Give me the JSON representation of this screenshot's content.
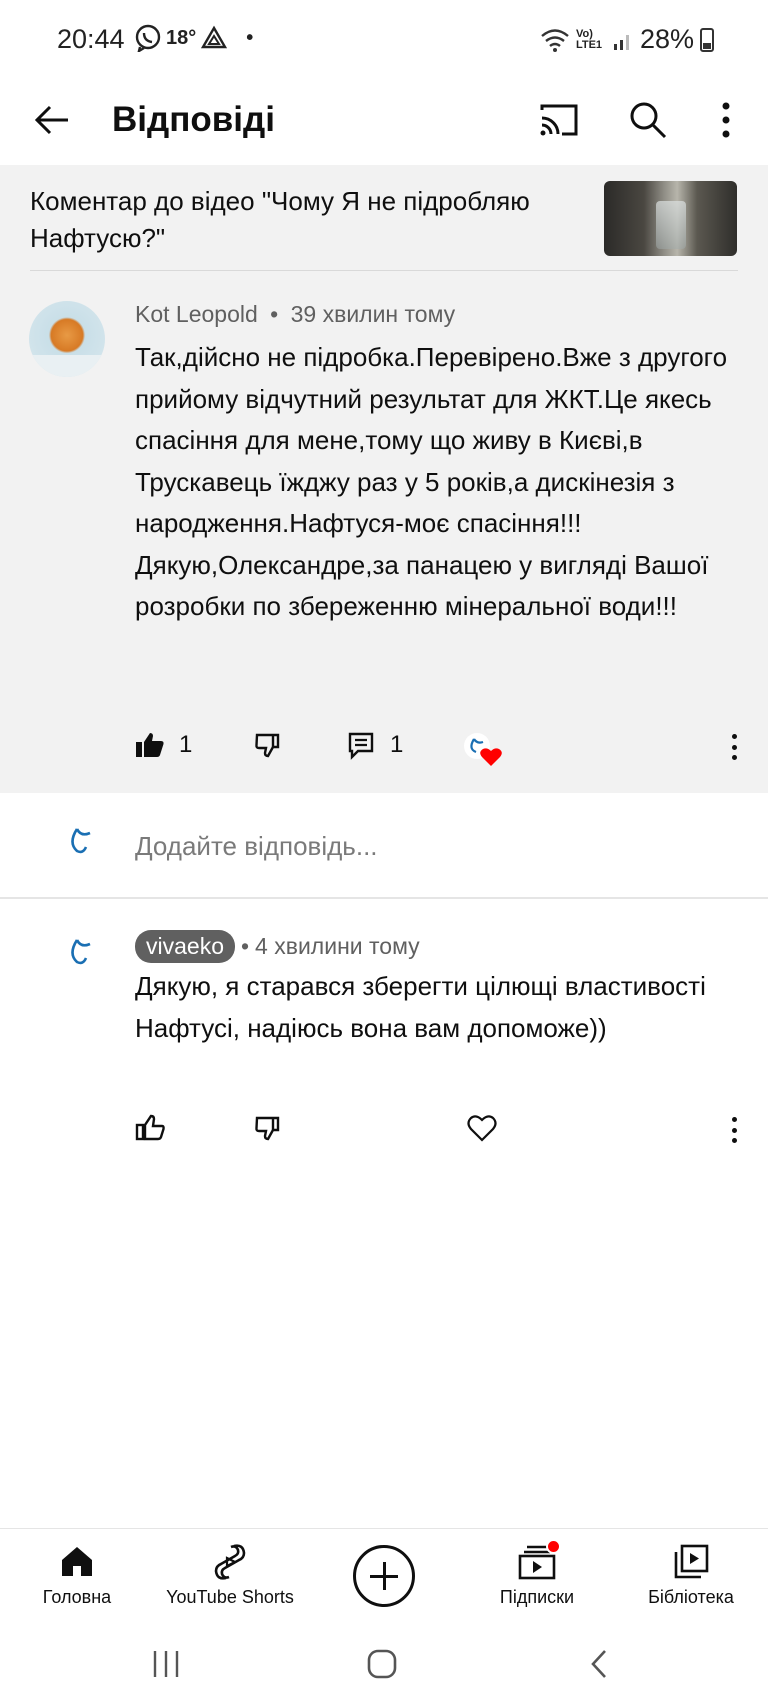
{
  "status_bar": {
    "time": "20:44",
    "temperature": "18°",
    "network": "Vo) LTE1",
    "battery": "28%"
  },
  "app_bar": {
    "title": "Відповіді",
    "icons": [
      "back-arrow-icon",
      "cast-icon",
      "search-icon",
      "more-vert-icon"
    ]
  },
  "context": {
    "text": "Коментар до відео \"Чому Я не підробляю Нафтусю?\""
  },
  "comment": {
    "author": "Kot Leopold",
    "separator": "•",
    "time": "39 хвилин тому",
    "text": "Так,дійсно не підробка.Перевірено.Вже з другого прийому відчутний результат для ЖКТ.Це якесь спасіння для мене,тому що живу в Києві,в Трускавець їжджу раз у 5 років,а дискінезія з народження.Нафтуся-моє спасіння!!! Дякую,Олександре,за панацею у вигляді Вашої розробки по збереженню мінеральної води!!!",
    "likes": "1",
    "replies": "1",
    "hearted": true
  },
  "reply_input": {
    "placeholder": "Додайте відповідь..."
  },
  "reply": {
    "author": "vivaeko",
    "separator": "•",
    "time": "4 хвилини тому",
    "text": "Дякую,  я старався зберегти цілющі властивості Нафтусі, надіюсь вона вам допоможе))"
  },
  "bottom_nav": {
    "items": [
      {
        "label": "Головна",
        "icon": "home-icon"
      },
      {
        "label": "YouTube Shorts",
        "icon": "shorts-icon"
      },
      {
        "label": "",
        "icon": "create-icon"
      },
      {
        "label": "Підписки",
        "icon": "subscriptions-icon"
      },
      {
        "label": "Бібліотека",
        "icon": "library-icon"
      }
    ]
  },
  "colors": {
    "context_bg": "#f2f2f2",
    "text": "#0f0f0f",
    "muted": "#606060",
    "heart": "#ff0000",
    "channel_logo": "#1a6fb3"
  }
}
